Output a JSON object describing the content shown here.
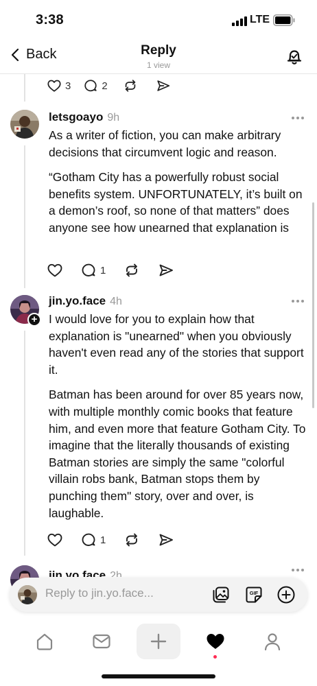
{
  "status_bar": {
    "time": "3:38",
    "network": "LTE"
  },
  "header": {
    "back_label": "Back",
    "title": "Reply",
    "subtitle": "1 view"
  },
  "top_actions": {
    "likes": "3",
    "replies": "2"
  },
  "posts": [
    {
      "username": "letsgoayo",
      "time": "9h",
      "paragraphs": [
        "As a writer of fiction, you can make arbitrary decisions that circumvent logic and reason.",
        "“Gotham City has a powerfully robust social benefits system. UNFORTUNATELY, it’s built on a demon’s roof, so none of that matters” does anyone see how unearned that explanation is"
      ],
      "likes": "",
      "replies": "1"
    },
    {
      "username": "jin.yo.face",
      "time": "4h",
      "paragraphs": [
        "I would love for you to explain how that explanation is \"unearned\" when you obviously haven't even read any of the stories that support it.",
        "Batman has been around for over 85 years now, with multiple monthly comic books that feature him, and even more that feature Gotham City. To imagine that the literally thousands of existing Batman stories are simply the same \"colorful villain robs bank, Batman stops them by punching them\" story, over and over, is laughable."
      ],
      "likes": "",
      "replies": "1"
    }
  ],
  "partial_post": {
    "username": "jin.yo.face",
    "time": "2h"
  },
  "composer": {
    "placeholder": "Reply to jin.yo.face..."
  },
  "tab_bar": {
    "items": [
      "home-icon",
      "inbox-icon",
      "create-icon",
      "activity-icon",
      "profile-icon"
    ],
    "active": "activity-icon"
  },
  "colors": {
    "accent_dot": "#ff2d55",
    "muted_text": "#999999",
    "thread_line": "#e2e2e2"
  }
}
